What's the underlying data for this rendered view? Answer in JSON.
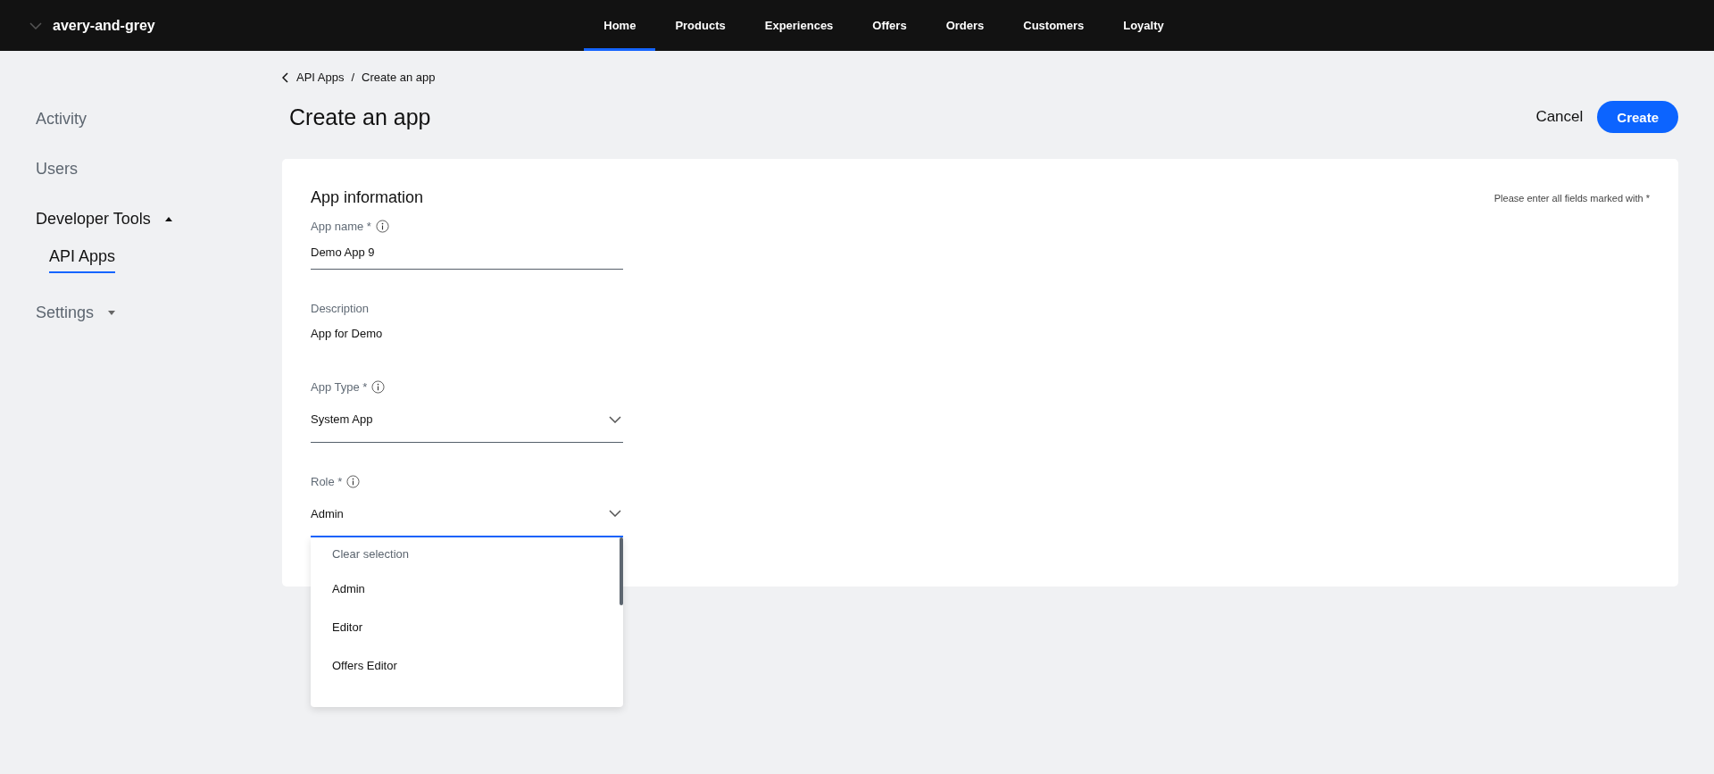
{
  "brand": {
    "name": "avery-and-grey"
  },
  "nav": [
    {
      "label": "Home",
      "selected": true
    },
    {
      "label": "Products",
      "selected": false
    },
    {
      "label": "Experiences",
      "selected": false
    },
    {
      "label": "Offers",
      "selected": false
    },
    {
      "label": "Orders",
      "selected": false
    },
    {
      "label": "Customers",
      "selected": false
    },
    {
      "label": "Loyalty",
      "selected": false
    }
  ],
  "sidebar": {
    "items": [
      {
        "label": "Activity",
        "kind": "link"
      },
      {
        "label": "Users",
        "kind": "link"
      },
      {
        "label": "Developer Tools",
        "kind": "group",
        "expanded": true,
        "children": [
          {
            "label": "API Apps",
            "selected": true
          }
        ]
      },
      {
        "label": "Settings",
        "kind": "group",
        "expanded": false
      }
    ]
  },
  "breadcrumb": [
    "API Apps",
    "Create an app"
  ],
  "breadcrumb_separator": "/",
  "page_title": "Create an app",
  "actions": {
    "cancel": "Cancel",
    "create": "Create"
  },
  "form": {
    "title": "App information",
    "hint": "Please enter all fields marked with *",
    "fields": [
      {
        "kind": "input",
        "label": "App name *",
        "info": true,
        "value": "Demo App 9",
        "focused": false
      },
      {
        "kind": "text",
        "label": "Description",
        "info": false,
        "value": "App for Demo"
      },
      {
        "kind": "select",
        "label": "App Type *",
        "info": true,
        "value": "System App",
        "focused": false
      },
      {
        "kind": "select",
        "label": "Role *",
        "info": true,
        "value": "Admin",
        "focused": true,
        "options": [
          {
            "label": "Clear selection",
            "kind": "clear"
          },
          {
            "label": "Admin",
            "kind": "option"
          },
          {
            "label": "Editor",
            "kind": "option"
          },
          {
            "label": "Offers Editor",
            "kind": "option"
          }
        ]
      }
    ]
  }
}
